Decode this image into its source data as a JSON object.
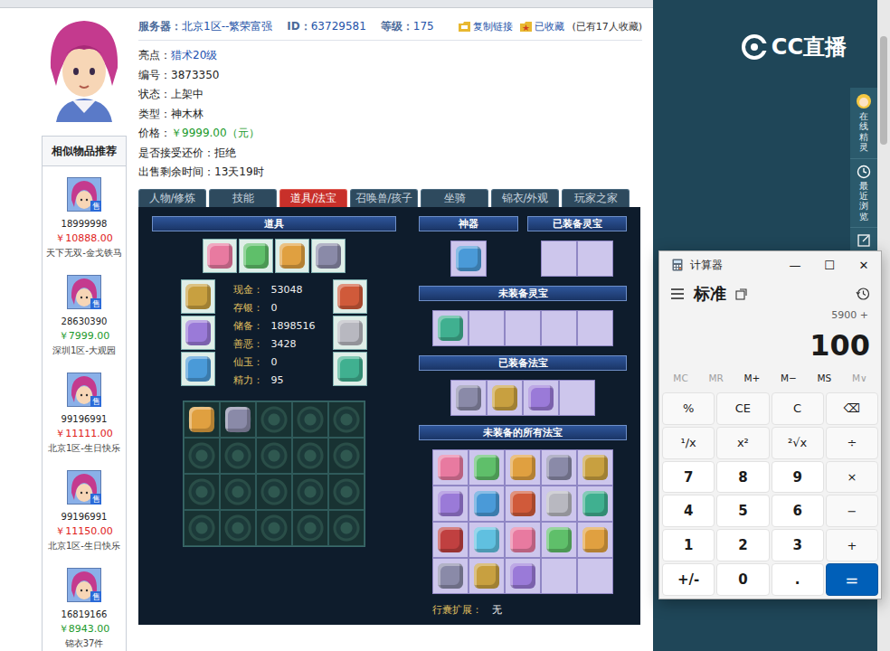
{
  "profile": {
    "header": [
      {
        "label": "服务器：",
        "value": "北京1区--繁荣富强"
      },
      {
        "label": "ID：",
        "value": "63729581"
      },
      {
        "label": "等级：",
        "value": "175"
      }
    ],
    "actions": [
      "复制链接",
      "已收藏"
    ],
    "fav_count": "(已有17人收藏)"
  },
  "info": [
    {
      "label": "亮点：",
      "value": "猎术20级",
      "color": "#2050b0"
    },
    {
      "label": "编号：",
      "value": "3873350",
      "color": "#222222"
    },
    {
      "label": "状态：",
      "value": "上架中",
      "color": "#222222"
    },
    {
      "label": "类型：",
      "value": "神木林",
      "color": "#222222"
    },
    {
      "label": "价格：",
      "value": "￥9999.00（元）",
      "color": "#1a9a2a"
    },
    {
      "label": "是否接受还价：",
      "value": "拒绝",
      "color": "#222222"
    },
    {
      "label": "出售剩余时间：",
      "value": "13天19时",
      "color": "#222222"
    }
  ],
  "similar": {
    "title": "相似物品推荐",
    "items": [
      {
        "badge": "售",
        "number": "18999998",
        "price": "￥10888.00",
        "color": "#e0201a",
        "server": "天下无双-金戈铁马"
      },
      {
        "badge": "售",
        "number": "28630390",
        "price": "￥7999.00",
        "color": "#1a9a2a",
        "server": "深圳1区-大观园"
      },
      {
        "badge": "售",
        "number": "99196991",
        "price": "￥11111.00",
        "color": "#e0201a",
        "server": "北京1区-生日快乐"
      },
      {
        "badge": "售",
        "number": "99196991",
        "price": "￥11150.00",
        "color": "#e0201a",
        "server": "北京1区-生日快乐"
      },
      {
        "badge": "售",
        "number": "16819166",
        "price": "￥8943.00",
        "color": "#1a9a2a",
        "server": "锦衣37件"
      }
    ]
  },
  "tabs": [
    {
      "label": "人物/修炼",
      "selected": false
    },
    {
      "label": "技能",
      "selected": false
    },
    {
      "label": "道具/法宝",
      "selected": true
    },
    {
      "label": "召唤兽/孩子",
      "selected": false
    },
    {
      "label": "坐骑",
      "selected": false
    },
    {
      "label": "锦衣/外观",
      "selected": false
    },
    {
      "label": "玩家之家",
      "selected": false
    }
  ],
  "props": {
    "title": "道具",
    "top_slots": [
      {
        "filled": true
      },
      {
        "filled": true
      },
      {
        "filled": true
      },
      {
        "filled": true
      }
    ],
    "left_equip": [
      {
        "filled": true
      },
      {
        "filled": true
      },
      {
        "filled": true
      }
    ],
    "right_equip": [
      {
        "filled": true
      },
      {
        "filled": true
      },
      {
        "filled": true
      }
    ],
    "stats": [
      {
        "label": "现金：",
        "value": "53048"
      },
      {
        "label": "存银：",
        "value": "0"
      },
      {
        "label": "储备：",
        "value": "1898516"
      },
      {
        "label": "善恶：",
        "value": "3428"
      },
      {
        "label": "仙玉：",
        "value": "0"
      },
      {
        "label": "精力：",
        "value": "95"
      }
    ],
    "bag": [
      {
        "filled": true
      },
      {
        "filled": true
      },
      {
        "filled": false
      },
      {
        "filled": false
      },
      {
        "filled": false
      },
      {
        "filled": false
      },
      {
        "filled": false
      },
      {
        "filled": false
      },
      {
        "filled": false
      },
      {
        "filled": false
      },
      {
        "filled": false
      },
      {
        "filled": false
      },
      {
        "filled": false
      },
      {
        "filled": false
      },
      {
        "filled": false
      },
      {
        "filled": false
      },
      {
        "filled": false
      },
      {
        "filled": false
      },
      {
        "filled": false
      },
      {
        "filled": false
      }
    ]
  },
  "treasures": {
    "artifact": {
      "title": "神器",
      "slots": [
        {
          "filled": true
        }
      ]
    },
    "equipped_lingbao": {
      "title": "已装备灵宝",
      "slots": [
        {
          "filled": false
        },
        {
          "filled": false
        }
      ]
    },
    "unequipped_lingbao": {
      "title": "未装备灵宝",
      "slots": [
        {
          "filled": true
        },
        {
          "filled": false
        },
        {
          "filled": false
        },
        {
          "filled": false
        },
        {
          "filled": false
        }
      ]
    },
    "equipped_fabao": {
      "title": "已装备法宝",
      "slots": [
        {
          "filled": true
        },
        {
          "filled": true
        },
        {
          "filled": true
        },
        {
          "filled": false
        }
      ]
    },
    "all_fabao": {
      "title": "未装备的所有法宝",
      "slots": [
        {
          "filled": true
        },
        {
          "filled": true
        },
        {
          "filled": true
        },
        {
          "filled": true
        },
        {
          "filled": true
        },
        {
          "filled": true
        },
        {
          "filled": true
        },
        {
          "filled": true
        },
        {
          "filled": true
        },
        {
          "filled": true
        },
        {
          "filled": true
        },
        {
          "filled": true
        },
        {
          "filled": true
        },
        {
          "filled": true
        },
        {
          "filled": true
        },
        {
          "filled": true
        },
        {
          "filled": true
        },
        {
          "filled": true
        },
        {
          "filled": false
        },
        {
          "filled": false
        }
      ]
    },
    "expansion": {
      "label": "行囊扩展：",
      "value": "无"
    }
  },
  "logo": {
    "text": "CC直播"
  },
  "tools": [
    {
      "label": "在线精灵"
    },
    {
      "label": "最近浏览"
    }
  ],
  "calculator": {
    "title": "计算器",
    "controls": [
      "—",
      "☐",
      "✕"
    ],
    "mode": "标准",
    "history": "5900 +",
    "display": "100",
    "memory": [
      {
        "label": "MC",
        "disabled": true
      },
      {
        "label": "MR",
        "disabled": true
      },
      {
        "label": "M+",
        "disabled": false
      },
      {
        "label": "M−",
        "disabled": false
      },
      {
        "label": "MS",
        "disabled": false
      },
      {
        "label": "M∨",
        "disabled": true
      }
    ],
    "keys": [
      {
        "label": "%",
        "kind": "op"
      },
      {
        "label": "CE",
        "kind": "op"
      },
      {
        "label": "C",
        "kind": "op"
      },
      {
        "label": "⌫",
        "kind": "op"
      },
      {
        "label": "¹/x",
        "kind": "op"
      },
      {
        "label": "x²",
        "kind": "op"
      },
      {
        "label": "²√x",
        "kind": "op"
      },
      {
        "label": "÷",
        "kind": "op"
      },
      {
        "label": "7",
        "kind": "num"
      },
      {
        "label": "8",
        "kind": "num"
      },
      {
        "label": "9",
        "kind": "num"
      },
      {
        "label": "×",
        "kind": "op"
      },
      {
        "label": "4",
        "kind": "num"
      },
      {
        "label": "5",
        "kind": "num"
      },
      {
        "label": "6",
        "kind": "num"
      },
      {
        "label": "−",
        "kind": "op"
      },
      {
        "label": "1",
        "kind": "num"
      },
      {
        "label": "2",
        "kind": "num"
      },
      {
        "label": "3",
        "kind": "num"
      },
      {
        "label": "+",
        "kind": "op"
      },
      {
        "label": "+/-",
        "kind": "num"
      },
      {
        "label": "0",
        "kind": "num"
      },
      {
        "label": ".",
        "kind": "num"
      },
      {
        "label": "=",
        "kind": "equals"
      }
    ]
  }
}
